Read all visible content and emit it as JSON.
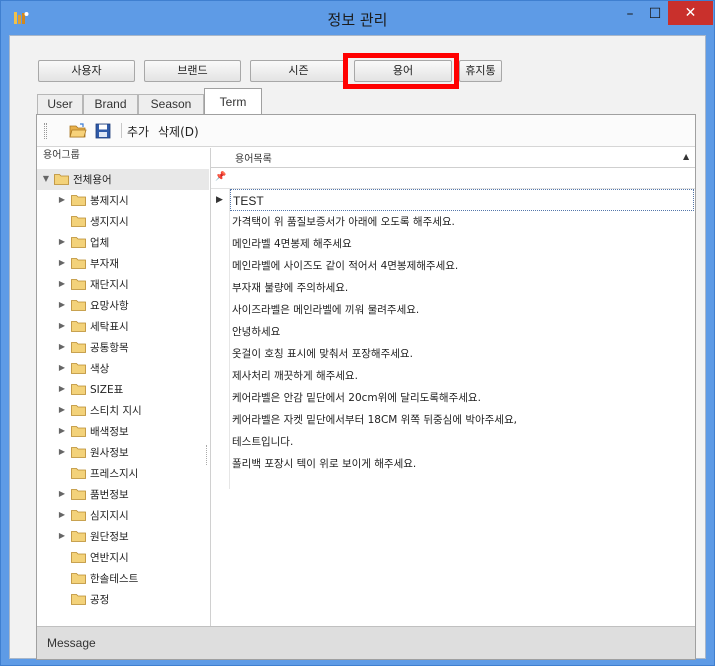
{
  "window": {
    "title": "정보 관리",
    "minimize_glyph": "–",
    "maximize_glyph": "☐",
    "close_glyph": "✕",
    "icon": "app-icon"
  },
  "top_buttons": [
    {
      "label": "사용자"
    },
    {
      "label": "브랜드"
    },
    {
      "label": "시즌"
    },
    {
      "label": "용어"
    },
    {
      "label": "휴지통"
    }
  ],
  "tabs": [
    {
      "label": "User"
    },
    {
      "label": "Brand"
    },
    {
      "label": "Season"
    },
    {
      "label": "Term",
      "active": true
    }
  ],
  "toolbar": {
    "open_icon": "folder-open-icon",
    "save_icon": "save-icon",
    "add_label": "추가",
    "delete_label": "삭제(D)"
  },
  "left_pane": {
    "header": "용어그룹",
    "root": {
      "label": "전체용어",
      "expanded": true
    },
    "items": [
      {
        "label": "봉제지시",
        "expandable": true
      },
      {
        "label": "생지지시",
        "expandable": false
      },
      {
        "label": "업체",
        "expandable": true
      },
      {
        "label": "부자재",
        "expandable": true
      },
      {
        "label": "재단지시",
        "expandable": true
      },
      {
        "label": "요망사항",
        "expandable": true
      },
      {
        "label": "세탁표시",
        "expandable": true
      },
      {
        "label": "공통항목",
        "expandable": true
      },
      {
        "label": "색상",
        "expandable": true
      },
      {
        "label": "SIZE표",
        "expandable": true
      },
      {
        "label": "스티치 지시",
        "expandable": true
      },
      {
        "label": "배색정보",
        "expandable": true
      },
      {
        "label": "원사정보",
        "expandable": true
      },
      {
        "label": "프레스지시",
        "expandable": false
      },
      {
        "label": "품번정보",
        "expandable": true
      },
      {
        "label": "심지지시",
        "expandable": true
      },
      {
        "label": "원단정보",
        "expandable": true
      },
      {
        "label": "연반지시",
        "expandable": false
      },
      {
        "label": "한솔테스트",
        "expandable": false
      },
      {
        "label": "공정",
        "expandable": false
      }
    ]
  },
  "right_pane": {
    "header": "용어목록",
    "rows": [
      "TEST",
      "가격택이 위 품질보증서가 아래에 오도록 해주세요.",
      "메인라벨 4면봉제 해주세요",
      "메인라벨에 사이즈도 같이 적어서 4면봉제해주세요.",
      "부자재 불량에 주의하세요.",
      "사이즈라벨은 메인라벨에 끼워 물려주세요.",
      "안녕하세요",
      "옷걸이 호칭 표시에 맞춰서 포장해주세요.",
      "제사처리  깨끗하게 해주세요.",
      "케어라벨은 안감 밑단에서 20cm위에 달리도록해주세요.",
      "케어라벨은 자켓 밑단에서부터 18CM 위쪽 뒤중심에 박아주세요,",
      "테스트입니다.",
      "폴리백 포장시 텍이 위로 보이게 해주세요."
    ],
    "selected_index": 0
  },
  "statusbar": {
    "message": "Message"
  }
}
